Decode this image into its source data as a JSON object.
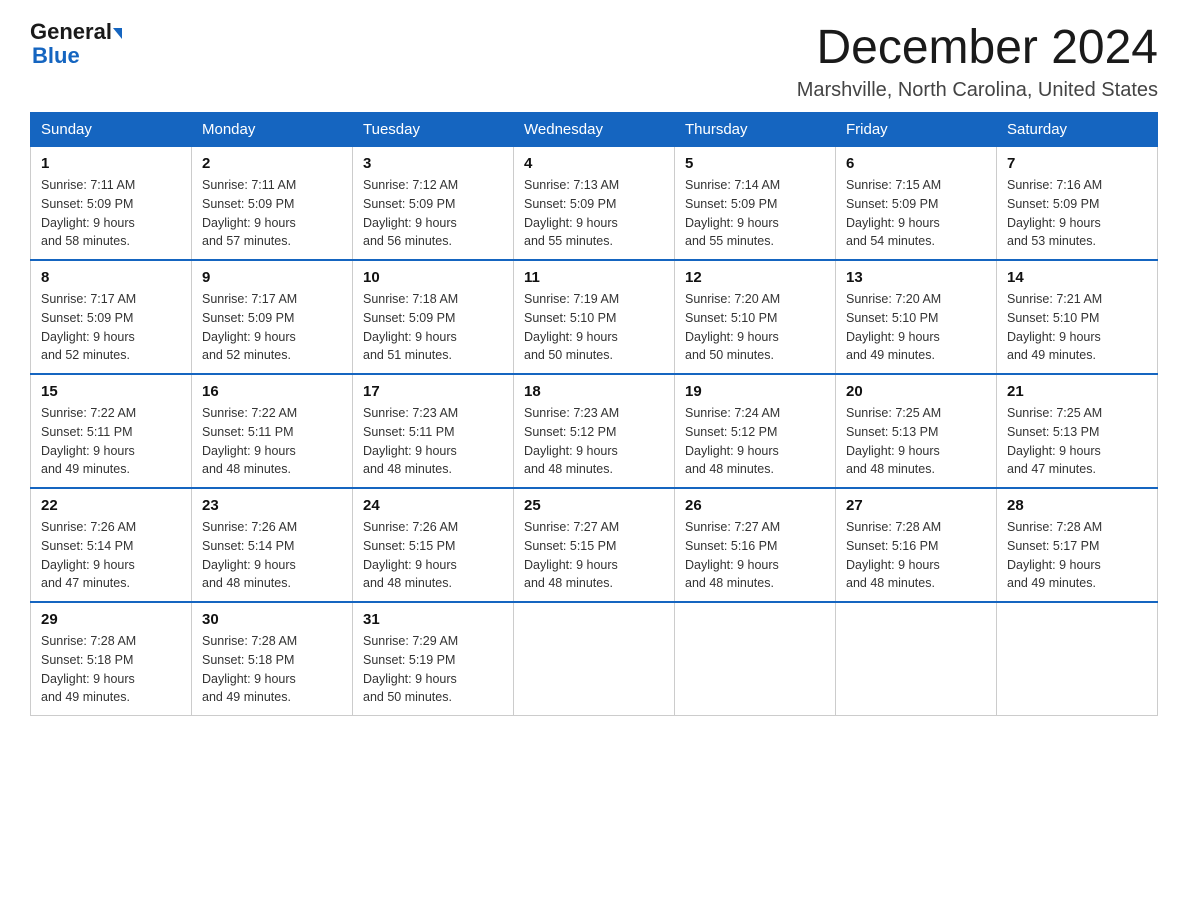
{
  "logo": {
    "part1": "General",
    "arrow": true,
    "part2": "Blue"
  },
  "title": "December 2024",
  "location": "Marshville, North Carolina, United States",
  "days_of_week": [
    "Sunday",
    "Monday",
    "Tuesday",
    "Wednesday",
    "Thursday",
    "Friday",
    "Saturday"
  ],
  "weeks": [
    [
      {
        "day": "1",
        "sunrise": "7:11 AM",
        "sunset": "5:09 PM",
        "daylight": "9 hours and 58 minutes."
      },
      {
        "day": "2",
        "sunrise": "7:11 AM",
        "sunset": "5:09 PM",
        "daylight": "9 hours and 57 minutes."
      },
      {
        "day": "3",
        "sunrise": "7:12 AM",
        "sunset": "5:09 PM",
        "daylight": "9 hours and 56 minutes."
      },
      {
        "day": "4",
        "sunrise": "7:13 AM",
        "sunset": "5:09 PM",
        "daylight": "9 hours and 55 minutes."
      },
      {
        "day": "5",
        "sunrise": "7:14 AM",
        "sunset": "5:09 PM",
        "daylight": "9 hours and 55 minutes."
      },
      {
        "day": "6",
        "sunrise": "7:15 AM",
        "sunset": "5:09 PM",
        "daylight": "9 hours and 54 minutes."
      },
      {
        "day": "7",
        "sunrise": "7:16 AM",
        "sunset": "5:09 PM",
        "daylight": "9 hours and 53 minutes."
      }
    ],
    [
      {
        "day": "8",
        "sunrise": "7:17 AM",
        "sunset": "5:09 PM",
        "daylight": "9 hours and 52 minutes."
      },
      {
        "day": "9",
        "sunrise": "7:17 AM",
        "sunset": "5:09 PM",
        "daylight": "9 hours and 52 minutes."
      },
      {
        "day": "10",
        "sunrise": "7:18 AM",
        "sunset": "5:09 PM",
        "daylight": "9 hours and 51 minutes."
      },
      {
        "day": "11",
        "sunrise": "7:19 AM",
        "sunset": "5:10 PM",
        "daylight": "9 hours and 50 minutes."
      },
      {
        "day": "12",
        "sunrise": "7:20 AM",
        "sunset": "5:10 PM",
        "daylight": "9 hours and 50 minutes."
      },
      {
        "day": "13",
        "sunrise": "7:20 AM",
        "sunset": "5:10 PM",
        "daylight": "9 hours and 49 minutes."
      },
      {
        "day": "14",
        "sunrise": "7:21 AM",
        "sunset": "5:10 PM",
        "daylight": "9 hours and 49 minutes."
      }
    ],
    [
      {
        "day": "15",
        "sunrise": "7:22 AM",
        "sunset": "5:11 PM",
        "daylight": "9 hours and 49 minutes."
      },
      {
        "day": "16",
        "sunrise": "7:22 AM",
        "sunset": "5:11 PM",
        "daylight": "9 hours and 48 minutes."
      },
      {
        "day": "17",
        "sunrise": "7:23 AM",
        "sunset": "5:11 PM",
        "daylight": "9 hours and 48 minutes."
      },
      {
        "day": "18",
        "sunrise": "7:23 AM",
        "sunset": "5:12 PM",
        "daylight": "9 hours and 48 minutes."
      },
      {
        "day": "19",
        "sunrise": "7:24 AM",
        "sunset": "5:12 PM",
        "daylight": "9 hours and 48 minutes."
      },
      {
        "day": "20",
        "sunrise": "7:25 AM",
        "sunset": "5:13 PM",
        "daylight": "9 hours and 48 minutes."
      },
      {
        "day": "21",
        "sunrise": "7:25 AM",
        "sunset": "5:13 PM",
        "daylight": "9 hours and 47 minutes."
      }
    ],
    [
      {
        "day": "22",
        "sunrise": "7:26 AM",
        "sunset": "5:14 PM",
        "daylight": "9 hours and 47 minutes."
      },
      {
        "day": "23",
        "sunrise": "7:26 AM",
        "sunset": "5:14 PM",
        "daylight": "9 hours and 48 minutes."
      },
      {
        "day": "24",
        "sunrise": "7:26 AM",
        "sunset": "5:15 PM",
        "daylight": "9 hours and 48 minutes."
      },
      {
        "day": "25",
        "sunrise": "7:27 AM",
        "sunset": "5:15 PM",
        "daylight": "9 hours and 48 minutes."
      },
      {
        "day": "26",
        "sunrise": "7:27 AM",
        "sunset": "5:16 PM",
        "daylight": "9 hours and 48 minutes."
      },
      {
        "day": "27",
        "sunrise": "7:28 AM",
        "sunset": "5:16 PM",
        "daylight": "9 hours and 48 minutes."
      },
      {
        "day": "28",
        "sunrise": "7:28 AM",
        "sunset": "5:17 PM",
        "daylight": "9 hours and 49 minutes."
      }
    ],
    [
      {
        "day": "29",
        "sunrise": "7:28 AM",
        "sunset": "5:18 PM",
        "daylight": "9 hours and 49 minutes."
      },
      {
        "day": "30",
        "sunrise": "7:28 AM",
        "sunset": "5:18 PM",
        "daylight": "9 hours and 49 minutes."
      },
      {
        "day": "31",
        "sunrise": "7:29 AM",
        "sunset": "5:19 PM",
        "daylight": "9 hours and 50 minutes."
      },
      null,
      null,
      null,
      null
    ]
  ],
  "labels": {
    "sunrise_prefix": "Sunrise: ",
    "sunset_prefix": "Sunset: ",
    "daylight_prefix": "Daylight: "
  }
}
